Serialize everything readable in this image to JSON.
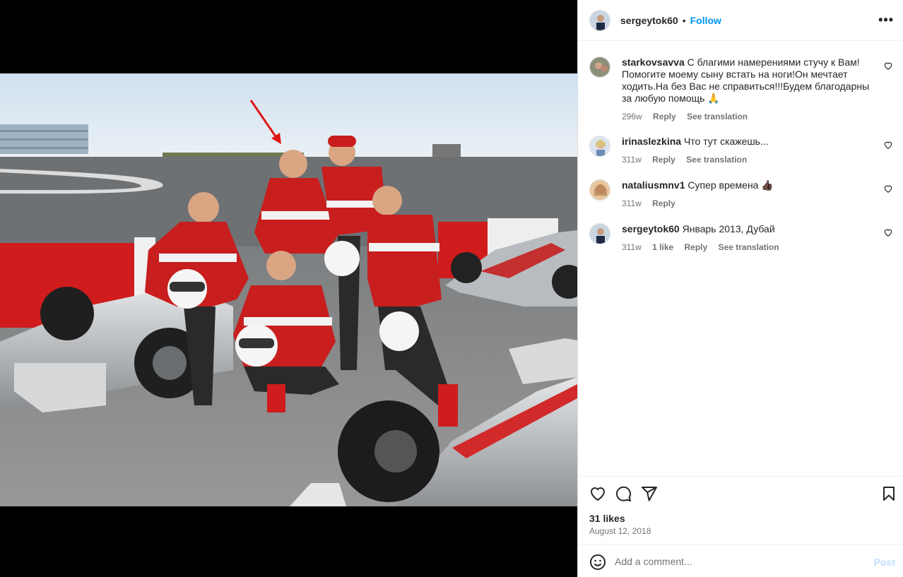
{
  "post": {
    "author": "sergeytok60",
    "separator": "•",
    "follow_label": "Follow",
    "more_label": "•••"
  },
  "comments": [
    {
      "user": "starkovsavva",
      "text": "С благими намерениями стучу к Вам! Помогите моему сыну встать на ноги!Он мечтает ходить.На без Вас не справиться!!!Будем благодарны за любую помощь 🙏",
      "age": "296w",
      "likes": "",
      "reply": "Reply",
      "translate": "See translation"
    },
    {
      "user": "irinaslezkina",
      "text": "Что тут скажешь...",
      "age": "311w",
      "likes": "",
      "reply": "Reply",
      "translate": "See translation"
    },
    {
      "user": "nataliusmnv1",
      "text": "Супер времена 👍🏿",
      "age": "311w",
      "likes": "",
      "reply": "Reply",
      "translate": ""
    },
    {
      "user": "sergeytok60",
      "text": "Январь 2013, Дубай",
      "age": "311w",
      "likes": "1 like",
      "reply": "Reply",
      "translate": "See translation"
    }
  ],
  "icons": {
    "like": "heart-icon",
    "comment": "comment-icon",
    "share": "share-icon",
    "save": "bookmark-icon",
    "emoji": "emoji-icon"
  },
  "stats": {
    "likes": "31 likes",
    "date": "August 12, 2018"
  },
  "composer": {
    "placeholder": "Add a comment...",
    "post_label": "Post"
  },
  "colors": {
    "accent": "#0095f6",
    "post_disabled": "#c0dffd",
    "muted": "#737373",
    "racing_red": "#d01c1c"
  }
}
